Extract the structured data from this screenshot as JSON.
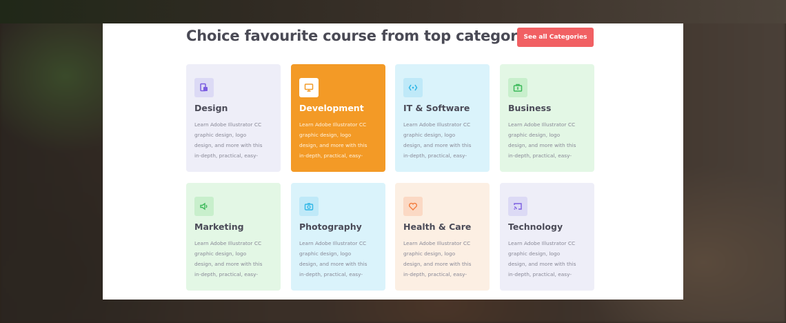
{
  "section": {
    "heading": "Choice favourite course from top category",
    "see_all_label": "See all Categories"
  },
  "categories": [
    {
      "title": "Design",
      "icon": "design-icon",
      "desc": "Learn Adobe Illustrator CC\ngraphic design, logo\ndesign, and more with this\nin-depth, practical, easy-"
    },
    {
      "title": "Development",
      "icon": "monitor-icon",
      "desc": "Learn Adobe Illustrator CC\ngraphic design, logo\ndesign, and more with this\nin-depth, practical, easy-"
    },
    {
      "title": "IT & Software",
      "icon": "code-icon",
      "desc": "Learn Adobe Illustrator CC\ngraphic design, logo\ndesign, and more with this\nin-depth, practical, easy-"
    },
    {
      "title": "Business",
      "icon": "briefcase-icon",
      "desc": "Learn Adobe Illustrator CC\ngraphic design, logo\ndesign, and more with this\nin-depth, practical, easy-"
    },
    {
      "title": "Marketing",
      "icon": "megaphone-icon",
      "desc": "Learn Adobe Illustrator CC\ngraphic design, logo\ndesign, and more with this\nin-depth, practical, easy-"
    },
    {
      "title": "Photography",
      "icon": "camera-icon",
      "desc": "Learn Adobe Illustrator CC\ngraphic design, logo\ndesign, and more with this\nin-depth, practical, easy-"
    },
    {
      "title": "Health & Care",
      "icon": "heart-icon",
      "desc": "Learn Adobe Illustrator CC\ngraphic design, logo\ndesign, and more with this\nin-depth, practical, easy-"
    },
    {
      "title": "Technology",
      "icon": "cast-icon",
      "desc": "Learn Adobe Illustrator CC\ngraphic design, logo\ndesign, and more with this\nin-depth, practical, easy-"
    }
  ],
  "colors": {
    "accent_button": "#f16063",
    "active_card": "#f39a26",
    "heading_text": "#4a4a55"
  }
}
